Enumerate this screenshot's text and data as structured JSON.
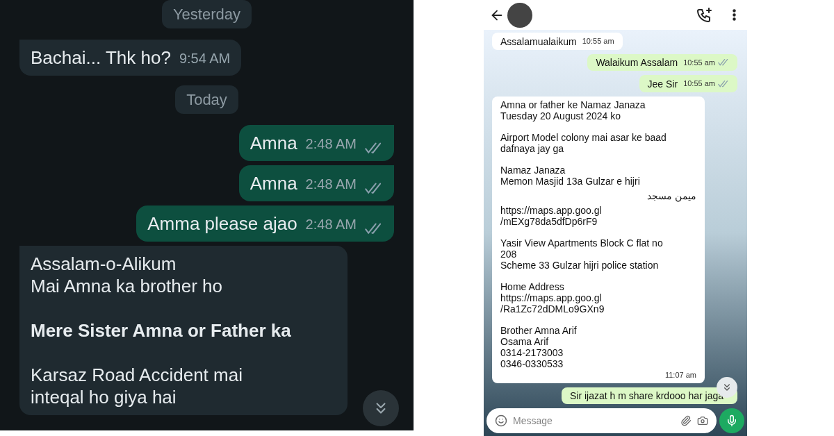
{
  "left_chat": {
    "messages": [
      {
        "kind": "date",
        "text": "Yesterday"
      },
      {
        "kind": "received",
        "text": "Bachai... Thk ho?",
        "time": "9:54 AM"
      },
      {
        "kind": "date",
        "text": "Today"
      },
      {
        "kind": "sent",
        "text": "Amna",
        "time": "2:48 AM",
        "read": true
      },
      {
        "kind": "sent",
        "text": "Amna",
        "time": "2:48 AM",
        "read": true
      },
      {
        "kind": "sent",
        "text": "Amma please ajao",
        "time": "2:48 AM",
        "read": true
      },
      {
        "kind": "received",
        "text": "Assalam-o-Alikum\nMai Amna ka brother ho\n\n**Mere Sister Amna or Father ka**\n\nKarsaz Road Accident mai\ninteqal ho giya hai"
      }
    ]
  },
  "right_chat": {
    "messages": [
      {
        "kind": "received",
        "paragraphs": [
          {
            "kind": "ltr",
            "text": "Assalamualaikum"
          }
        ],
        "time": "10:55 am"
      },
      {
        "kind": "sent",
        "paragraphs": [
          {
            "kind": "ltr",
            "text": "Walaikum Assalam"
          }
        ],
        "time": "10:55 am",
        "read": true
      },
      {
        "kind": "sent",
        "paragraphs": [
          {
            "kind": "ltr",
            "text": "Jee Sir"
          }
        ],
        "time": "10:55 am",
        "read": true
      },
      {
        "kind": "received",
        "paragraphs": [
          {
            "kind": "ltr",
            "text": "Amna or father ke Namaz Janaza\nTuesday 20 August 2024 ko"
          },
          {
            "kind": "ltr",
            "text": "Airport Model colony mai asar ke baad\ndafnaya jay ga"
          },
          {
            "kind": "ltr",
            "text": "Namaz Janaza\nMemon Masjid 13a Gulzar e hijri"
          },
          {
            "kind": "rtl",
            "text": "میمن مسجد"
          },
          {
            "kind": "ltr",
            "text": "https://maps.app.goo.gl\n/mEXg78da5dfDp6rF9"
          },
          {
            "kind": "ltr",
            "text": "Yasir View Apartments Block C flat no\n208\nScheme 33 Gulzar hijri police station"
          },
          {
            "kind": "ltr",
            "text": "Home Address\nhttps://maps.app.goo.gl\n/Ra1Zc72dDMLo9GXn9"
          },
          {
            "kind": "ltr",
            "text": "Brother Amna Arif\nOsama Arif\n0314-2173003\n0346-0330533"
          }
        ],
        "time": "11:07 am"
      },
      {
        "kind": "sent",
        "paragraphs": [
          {
            "kind": "ltr",
            "text": "Sir ijazat h m share krdooo har jaga"
          }
        ]
      }
    ],
    "composer": {
      "placeholder": "Message"
    }
  }
}
